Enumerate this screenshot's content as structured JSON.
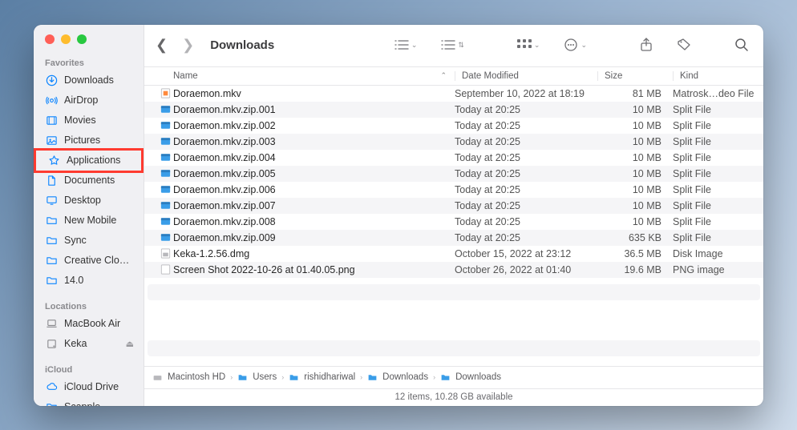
{
  "window_title": "Downloads",
  "sidebar": {
    "favorites_label": "Favorites",
    "locations_label": "Locations",
    "icloud_label": "iCloud",
    "items_fav": [
      {
        "label": "Downloads",
        "icon": "download"
      },
      {
        "label": "AirDrop",
        "icon": "airdrop"
      },
      {
        "label": "Movies",
        "icon": "movies"
      },
      {
        "label": "Pictures",
        "icon": "pictures"
      },
      {
        "label": "Applications",
        "icon": "applications",
        "hl": true
      },
      {
        "label": "Documents",
        "icon": "documents"
      },
      {
        "label": "Desktop",
        "icon": "desktop"
      },
      {
        "label": "New Mobile",
        "icon": "folder"
      },
      {
        "label": "Sync",
        "icon": "folder"
      },
      {
        "label": "Creative Clo…",
        "icon": "folder"
      },
      {
        "label": "14.0",
        "icon": "folder"
      }
    ],
    "items_loc": [
      {
        "label": "MacBook Air",
        "icon": "laptop"
      },
      {
        "label": "Keka",
        "icon": "disk",
        "eject": true
      }
    ],
    "items_icloud": [
      {
        "label": "iCloud Drive",
        "icon": "icloud"
      },
      {
        "label": "Scapple",
        "icon": "folder"
      }
    ]
  },
  "columns": {
    "name": "Name",
    "date": "Date Modified",
    "size": "Size",
    "kind": "Kind"
  },
  "files": [
    {
      "name": "Doraemon.mkv",
      "date": "September 10, 2022 at 18:19",
      "size": "81 MB",
      "kind": "Matrosk…deo File",
      "icon": "video"
    },
    {
      "name": "Doraemon.mkv.zip.001",
      "date": "Today at 20:25",
      "size": "10 MB",
      "kind": "Split File",
      "icon": "zip"
    },
    {
      "name": "Doraemon.mkv.zip.002",
      "date": "Today at 20:25",
      "size": "10 MB",
      "kind": "Split File",
      "icon": "zip"
    },
    {
      "name": "Doraemon.mkv.zip.003",
      "date": "Today at 20:25",
      "size": "10 MB",
      "kind": "Split File",
      "icon": "zip"
    },
    {
      "name": "Doraemon.mkv.zip.004",
      "date": "Today at 20:25",
      "size": "10 MB",
      "kind": "Split File",
      "icon": "zip"
    },
    {
      "name": "Doraemon.mkv.zip.005",
      "date": "Today at 20:25",
      "size": "10 MB",
      "kind": "Split File",
      "icon": "zip"
    },
    {
      "name": "Doraemon.mkv.zip.006",
      "date": "Today at 20:25",
      "size": "10 MB",
      "kind": "Split File",
      "icon": "zip"
    },
    {
      "name": "Doraemon.mkv.zip.007",
      "date": "Today at 20:25",
      "size": "10 MB",
      "kind": "Split File",
      "icon": "zip"
    },
    {
      "name": "Doraemon.mkv.zip.008",
      "date": "Today at 20:25",
      "size": "10 MB",
      "kind": "Split File",
      "icon": "zip"
    },
    {
      "name": "Doraemon.mkv.zip.009",
      "date": "Today at 20:25",
      "size": "635 KB",
      "kind": "Split File",
      "icon": "zip"
    },
    {
      "name": "Keka-1.2.56.dmg",
      "date": "October 15, 2022 at 23:12",
      "size": "36.5 MB",
      "kind": "Disk Image",
      "icon": "dmg"
    },
    {
      "name": "Screen Shot 2022-10-26 at 01.40.05.png",
      "date": "October 26, 2022 at 01:40",
      "size": "19.6 MB",
      "kind": "PNG image",
      "icon": "png"
    }
  ],
  "path": [
    {
      "label": "Macintosh HD",
      "icon": "hdd"
    },
    {
      "label": "Users",
      "icon": "folder"
    },
    {
      "label": "rishidhariwal",
      "icon": "folder"
    },
    {
      "label": "Downloads",
      "icon": "folder"
    },
    {
      "label": "Downloads",
      "icon": "folder"
    }
  ],
  "status": "12 items, 10.28 GB available"
}
